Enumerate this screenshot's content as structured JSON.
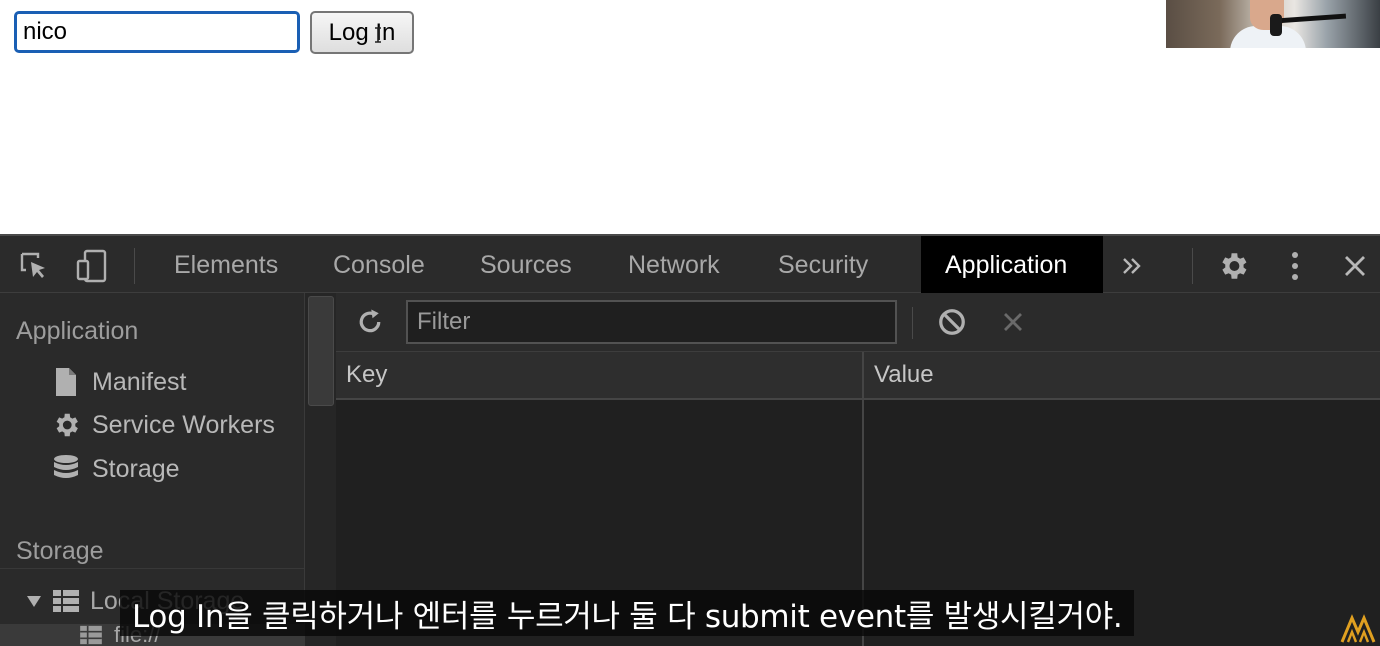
{
  "webpage": {
    "username_value": "nico",
    "login_label": "Log In"
  },
  "devtools": {
    "tabs": [
      {
        "label": "Elements",
        "active": false
      },
      {
        "label": "Console",
        "active": false
      },
      {
        "label": "Sources",
        "active": false
      },
      {
        "label": "Network",
        "active": false
      },
      {
        "label": "Security",
        "active": false
      },
      {
        "label": "Application",
        "active": true
      }
    ],
    "icons": {
      "inspect": "inspect-element-icon",
      "device": "device-toolbar-icon",
      "more_tabs": "chevron-double-right-icon",
      "settings": "gear-icon",
      "menu": "kebab-menu-icon",
      "close": "close-icon"
    },
    "sidebar": {
      "application_title": "Application",
      "application_items": [
        {
          "label": "Manifest",
          "icon": "file-icon"
        },
        {
          "label": "Service Workers",
          "icon": "gear-icon"
        },
        {
          "label": "Storage",
          "icon": "database-icon"
        }
      ],
      "storage_title": "Storage",
      "storage_items": [
        {
          "label": "Local Storage",
          "icon": "grid-icon",
          "expanded": true
        },
        {
          "label": "file://",
          "icon": "grid-icon"
        }
      ]
    },
    "main": {
      "filter_placeholder": "Filter",
      "columns": [
        "Key",
        "Value"
      ],
      "rows": []
    }
  },
  "subtitle": "Log In을 클릭하거나 엔터를 누르거나 둘 다 submit event를 발생시킬거야.",
  "colors": {
    "accent": "#1a5fb4",
    "devtools_bg": "#242424",
    "active_tab_bg": "#000000"
  }
}
